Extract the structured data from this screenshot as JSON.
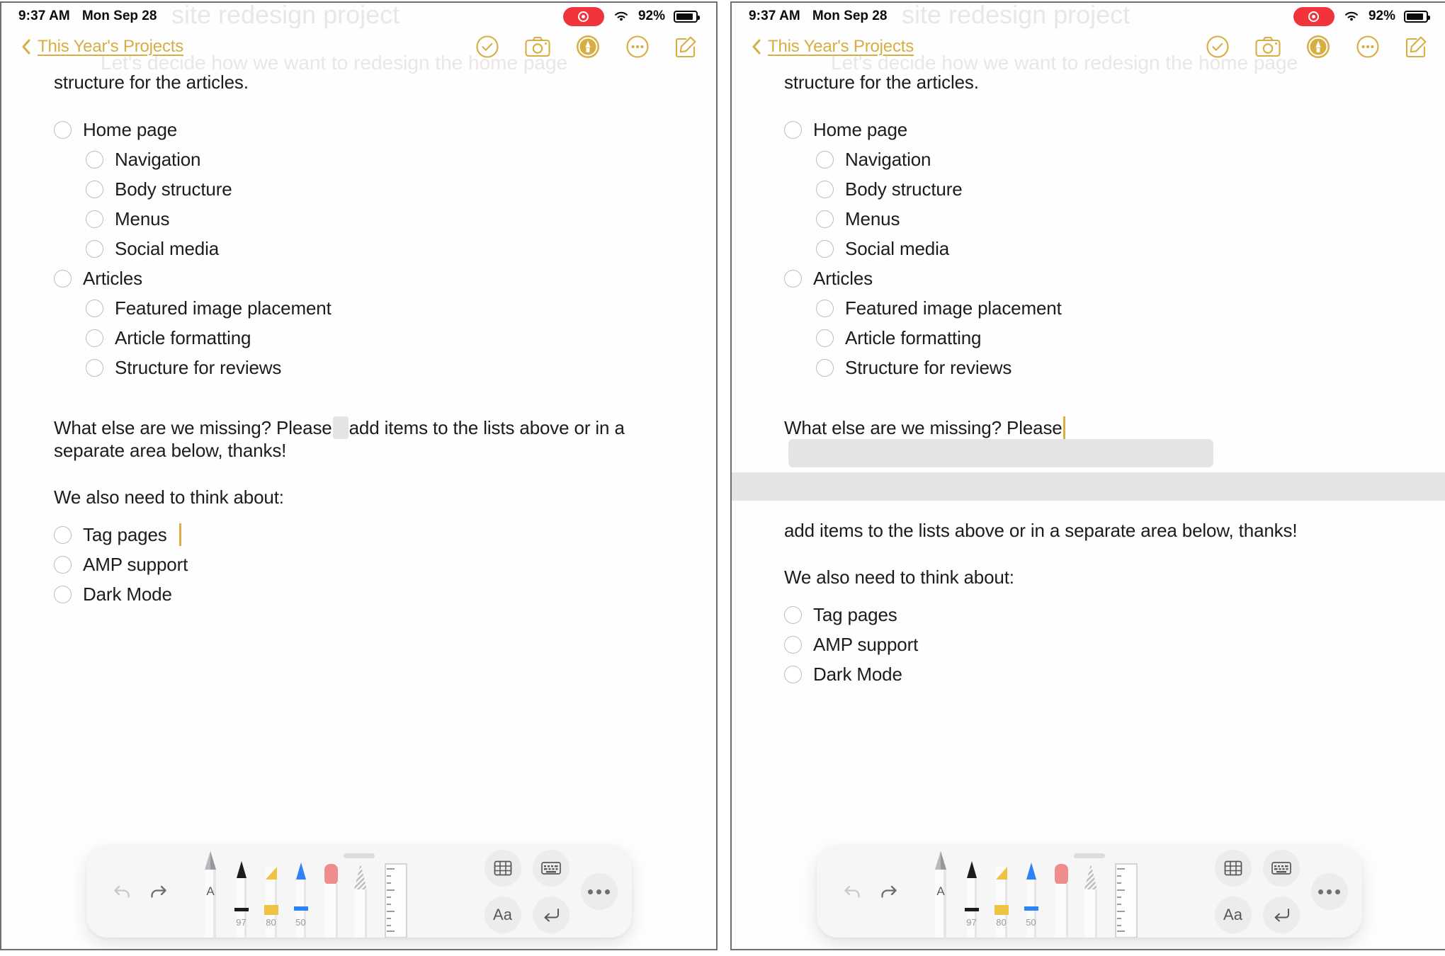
{
  "status_bar": {
    "time": "9:37 AM",
    "date": "Mon Sep 28",
    "battery_percent": "92%",
    "recording_icon": "screen-recording-indicator",
    "wifi_icon": "wifi-icon",
    "battery_icon": "battery-icon"
  },
  "nav_bar": {
    "back_label": "This Year's Projects",
    "back_icon": "chevron-left-icon",
    "actions": [
      {
        "name": "checklist-button",
        "icon": "check-circle-icon"
      },
      {
        "name": "camera-button",
        "icon": "camera-icon"
      },
      {
        "name": "markup-button",
        "icon": "markup-pen-circle-icon"
      },
      {
        "name": "more-button",
        "icon": "ellipsis-circle-icon"
      },
      {
        "name": "compose-button",
        "icon": "compose-icon"
      }
    ]
  },
  "ghost_text": {
    "line1": "site redesign project",
    "line2": "Let's decide how we want to redesign the home page"
  },
  "note": {
    "lead_paragraph": "structure for the articles.",
    "checklist": [
      {
        "label": "Home page",
        "indent": 0
      },
      {
        "label": "Navigation",
        "indent": 1
      },
      {
        "label": "Body structure",
        "indent": 1
      },
      {
        "label": "Menus",
        "indent": 1
      },
      {
        "label": "Social media",
        "indent": 1
      },
      {
        "label": "Articles",
        "indent": 0
      },
      {
        "label": "Featured image placement",
        "indent": 1
      },
      {
        "label": "Article formatting",
        "indent": 1
      },
      {
        "label": "Structure for reviews",
        "indent": 1
      }
    ],
    "prompt_before": "What else are we missing? Please",
    "prompt_after": "add items to the lists above or in a separate area below, thanks!",
    "prompt_full_line1": "What else are we missing? Please add items to the lists above or in a separate area",
    "prompt_full_line2": "below, thanks!",
    "think_about_heading": "We also need to think about:",
    "think_about_items": [
      {
        "label": "Tag pages"
      },
      {
        "label": "AMP support"
      },
      {
        "label": "Dark Mode"
      }
    ]
  },
  "palette": {
    "undo_icon": "undo-arrow-icon",
    "redo_icon": "redo-arrow-icon",
    "tools": [
      {
        "name": "scribble-pen-tool",
        "label": "A",
        "opacity": ""
      },
      {
        "name": "pencil-tool",
        "label": "",
        "opacity": "97"
      },
      {
        "name": "highlighter-tool",
        "label": "",
        "opacity": "80"
      },
      {
        "name": "pen-tool",
        "label": "",
        "opacity": "50"
      },
      {
        "name": "eraser-tool",
        "label": "",
        "opacity": ""
      },
      {
        "name": "lasso-tool",
        "label": "",
        "opacity": ""
      },
      {
        "name": "ruler-tool",
        "label": "",
        "opacity": ""
      }
    ],
    "table_icon": "table-icon",
    "text_style_label": "Aa",
    "keyboard_icon": "keyboard-icon",
    "return_icon": "return-arrow-icon",
    "more_icon": "ellipsis-icon"
  },
  "colors": {
    "accent": "#d6ae42",
    "recording": "#f1343c",
    "highlight_gray": "#e4e4e6",
    "pencil_band": "#1c1c1e",
    "highlighter_band": "#edc341",
    "pen_band": "#2f82f5",
    "eraser_tip": "#ef8d8d"
  },
  "panels": [
    {
      "name": "before-panel",
      "scribble_expanded": false
    },
    {
      "name": "after-panel",
      "scribble_expanded": true
    }
  ]
}
